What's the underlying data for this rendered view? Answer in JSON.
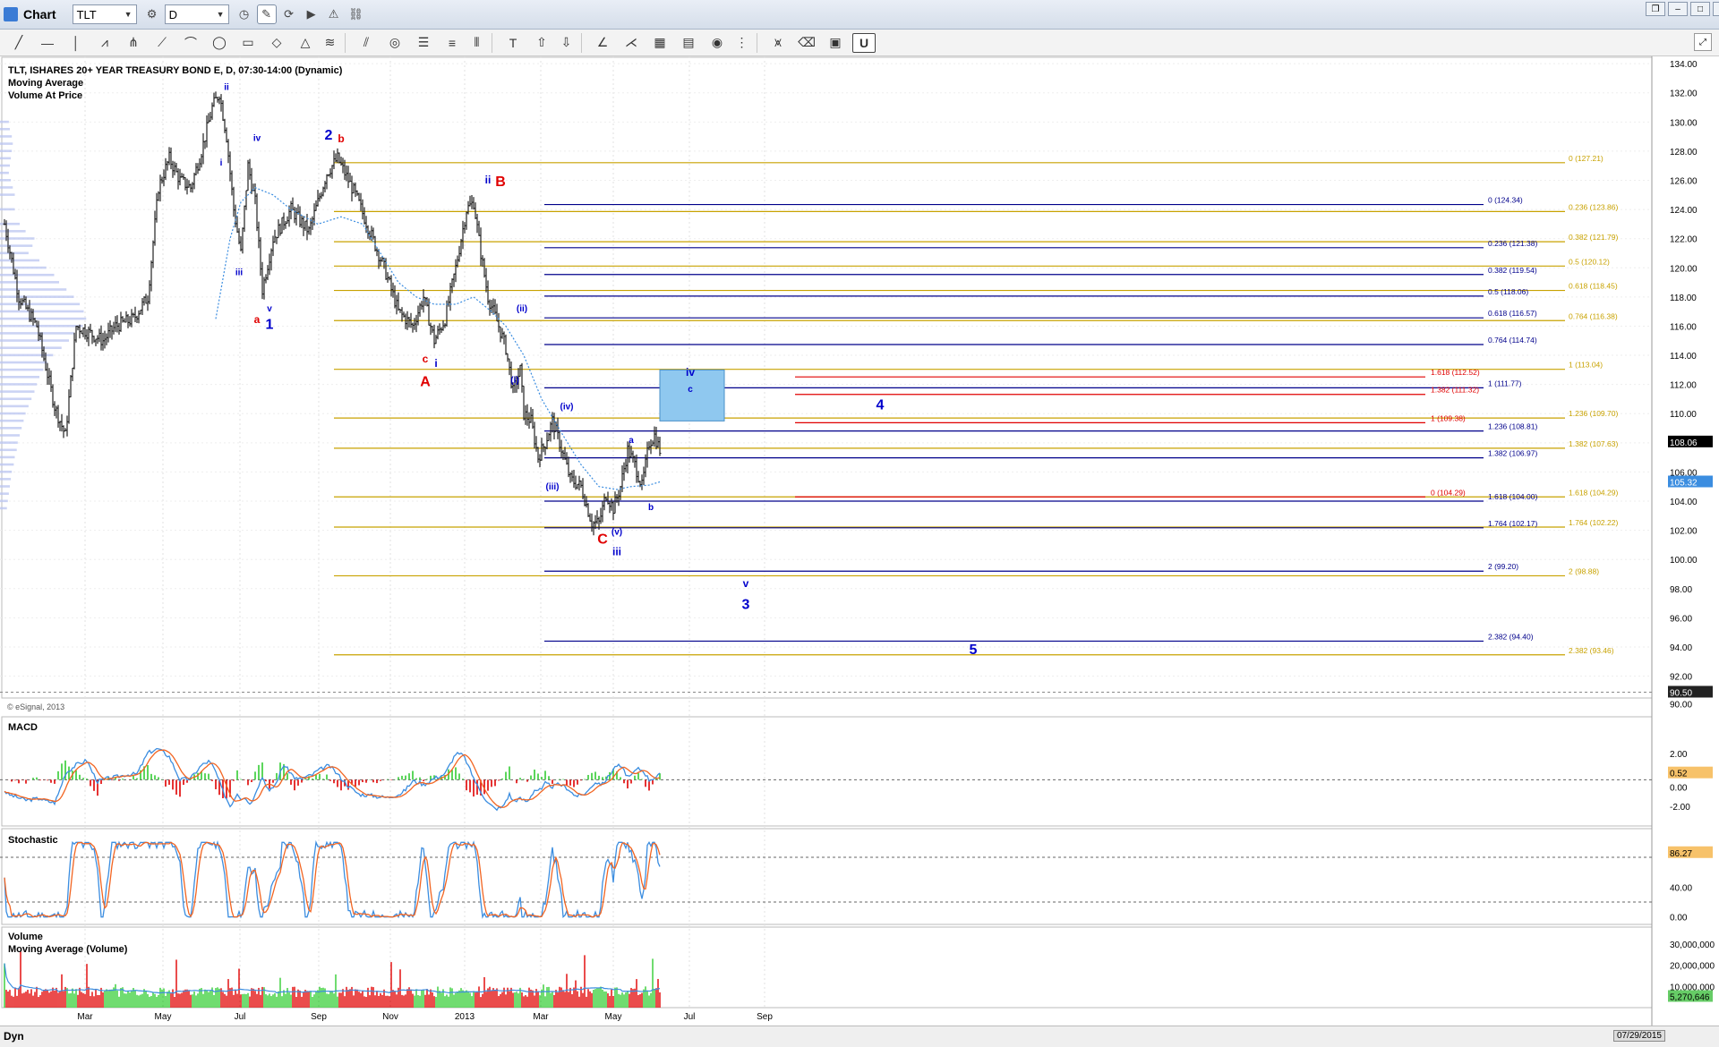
{
  "window": {
    "title": "Chart",
    "symbol": "TLT",
    "interval": "D"
  },
  "legend": {
    "title": "TLT, ISHARES 20+ YEAR TREASURY BOND E, D, 07:30-14:00 (Dynamic)",
    "ind1": "Moving Average",
    "ind2": "Volume At Price",
    "copyright": "© eSignal, 2013"
  },
  "colors": {
    "gold": "#c8a200",
    "blue": "#00008b",
    "red": "#e00000",
    "wave_blue": "#0000cc",
    "ma": "#3b8de0",
    "macd_orange": "#f26522",
    "green": "#33cc33",
    "box_fill": "#8fc8ef"
  },
  "chart_data": [
    {
      "type": "bar",
      "title": "TLT, ISHARES 20+ YEAR TREASURY BOND E, D, 07:30-14:00 (Dynamic)",
      "x_ticks": [
        "Mar",
        "May",
        "Jul",
        "Sep",
        "Nov",
        "2013",
        "Mar",
        "May",
        "Jul",
        "Sep"
      ],
      "ylim": [
        90.5,
        134.5
      ],
      "y_ticks": [
        134,
        132,
        130,
        128,
        126,
        124,
        122,
        120,
        118,
        116,
        114,
        112,
        110,
        108,
        106,
        104,
        102,
        100,
        98,
        96,
        94,
        92
      ],
      "last_price": "108.06",
      "ma_value": "105.32",
      "lower_value": "90.50",
      "lower_tick": "90.00",
      "ohlc_keyframes": [
        [
          0,
          123
        ],
        [
          8,
          118
        ],
        [
          18,
          116
        ],
        [
          28,
          110.5
        ],
        [
          34,
          108.5
        ],
        [
          40,
          116
        ],
        [
          48,
          115.5
        ],
        [
          55,
          115
        ],
        [
          62,
          116
        ],
        [
          72,
          116.5
        ],
        [
          80,
          118
        ],
        [
          86,
          125.5
        ],
        [
          92,
          127.5
        ],
        [
          98,
          126
        ],
        [
          104,
          125.5
        ],
        [
          110,
          128
        ],
        [
          116,
          131
        ],
        [
          120,
          132
        ],
        [
          124,
          129
        ],
        [
          128,
          124
        ],
        [
          132,
          121
        ],
        [
          136,
          127
        ],
        [
          140,
          124.5
        ],
        [
          144,
          118.5
        ],
        [
          150,
          122
        ],
        [
          160,
          124
        ],
        [
          170,
          122.5
        ],
        [
          180,
          126.5
        ],
        [
          186,
          127.5
        ],
        [
          196,
          125
        ],
        [
          204,
          122.5
        ],
        [
          212,
          120
        ],
        [
          220,
          117
        ],
        [
          228,
          116
        ],
        [
          234,
          118
        ],
        [
          240,
          115
        ],
        [
          246,
          116.5
        ],
        [
          252,
          120
        ],
        [
          258,
          124
        ],
        [
          262,
          124.5
        ],
        [
          266,
          121
        ],
        [
          270,
          118
        ],
        [
          276,
          116
        ],
        [
          280,
          114.5
        ],
        [
          284,
          111.5
        ],
        [
          288,
          113
        ],
        [
          290,
          110
        ],
        [
          294,
          109.5
        ],
        [
          298,
          107
        ],
        [
          302,
          108
        ],
        [
          306,
          109.5
        ],
        [
          310,
          108
        ],
        [
          316,
          105.5
        ],
        [
          322,
          105
        ],
        [
          328,
          102.5
        ],
        [
          332,
          102.5
        ],
        [
          336,
          104.5
        ],
        [
          340,
          103.5
        ],
        [
          344,
          105
        ],
        [
          348,
          107.5
        ],
        [
          352,
          106.5
        ],
        [
          356,
          105
        ],
        [
          360,
          108
        ],
        [
          363,
          108.5
        ],
        [
          366,
          107.5
        ]
      ],
      "moving_average": [
        [
          118,
          116.5
        ],
        [
          126,
          122
        ],
        [
          132,
          124.5
        ],
        [
          140,
          125.5
        ],
        [
          150,
          125
        ],
        [
          160,
          124
        ],
        [
          175,
          123
        ],
        [
          188,
          123.5
        ],
        [
          200,
          123
        ],
        [
          210,
          121
        ],
        [
          220,
          119
        ],
        [
          230,
          118
        ],
        [
          240,
          117.5
        ],
        [
          252,
          117.5
        ],
        [
          262,
          118
        ],
        [
          272,
          117
        ],
        [
          280,
          116
        ],
        [
          290,
          114
        ],
        [
          300,
          111
        ],
        [
          312,
          108.5
        ],
        [
          322,
          106.5
        ],
        [
          332,
          105
        ],
        [
          342,
          104.8
        ],
        [
          350,
          105
        ],
        [
          360,
          105.1
        ],
        [
          366,
          105.32
        ]
      ],
      "fib_gold": [
        {
          "level": "0",
          "value": 127.21
        },
        {
          "level": "0.236",
          "value": 123.86
        },
        {
          "level": "0.382",
          "value": 121.79
        },
        {
          "level": "0.5",
          "value": 120.12
        },
        {
          "level": "0.618",
          "value": 118.45
        },
        {
          "level": "0.764",
          "value": 116.38
        },
        {
          "level": "1",
          "value": 113.04
        },
        {
          "level": "1.236",
          "value": 109.7
        },
        {
          "level": "1.382",
          "value": 107.63
        },
        {
          "level": "1.618",
          "value": 104.29
        },
        {
          "level": "1.764",
          "value": 102.22
        },
        {
          "level": "2",
          "value": 98.88
        },
        {
          "level": "2.382",
          "value": 93.46
        }
      ],
      "fib_blue": [
        {
          "level": "0",
          "value": 124.34
        },
        {
          "level": "0.236",
          "value": 121.38
        },
        {
          "level": "0.382",
          "value": 119.54
        },
        {
          "level": "0.5",
          "value": 118.06
        },
        {
          "level": "0.618",
          "value": 116.57
        },
        {
          "level": "0.764",
          "value": 114.74
        },
        {
          "level": "1",
          "value": 111.77
        },
        {
          "level": "1.236",
          "value": 108.81
        },
        {
          "level": "1.382",
          "value": 106.97
        },
        {
          "level": "1.618",
          "value": 104.0
        },
        {
          "level": "1.764",
          "value": 102.17
        },
        {
          "level": "2",
          "value": 99.2
        },
        {
          "level": "2.382",
          "value": 94.4
        }
      ],
      "fib_red": [
        {
          "level": "0",
          "value": 104.29
        },
        {
          "level": "1",
          "value": 109.38
        },
        {
          "level": "1.382",
          "value": 111.32
        },
        {
          "level": "1.618",
          "value": 112.52
        }
      ],
      "target_box": {
        "x_from": 366,
        "x_to": 402,
        "y_from": 109.5,
        "y_to": 113.0
      },
      "wave_labels": [
        {
          "t": "ii",
          "x": 124,
          "y": 132.2,
          "c": "b",
          "s": "s"
        },
        {
          "t": "i",
          "x": 121,
          "y": 127,
          "c": "b",
          "s": "s"
        },
        {
          "t": "iii",
          "x": 131,
          "y": 119.5,
          "c": "b",
          "s": "s"
        },
        {
          "t": "iv",
          "x": 141,
          "y": 128.7,
          "c": "b",
          "s": "s"
        },
        {
          "t": "v",
          "x": 148,
          "y": 117,
          "c": "b",
          "s": "s"
        },
        {
          "t": "a",
          "x": 141,
          "y": 116.2,
          "c": "r",
          "s": "m"
        },
        {
          "t": "1",
          "x": 148,
          "y": 115.8,
          "c": "b",
          "s": "l"
        },
        {
          "t": "2",
          "x": 181,
          "y": 128.8,
          "c": "b",
          "s": "l"
        },
        {
          "t": "b",
          "x": 188,
          "y": 128.6,
          "c": "r",
          "s": "m"
        },
        {
          "t": "c",
          "x": 235,
          "y": 113.5,
          "c": "r",
          "s": "m"
        },
        {
          "t": "i",
          "x": 241,
          "y": 113.2,
          "c": "b",
          "s": "m"
        },
        {
          "t": "A",
          "x": 235,
          "y": 111.9,
          "c": "r",
          "s": "l"
        },
        {
          "t": "ii",
          "x": 270,
          "y": 125.8,
          "c": "b",
          "s": "m"
        },
        {
          "t": "B",
          "x": 277,
          "y": 125.6,
          "c": "r",
          "s": "l"
        },
        {
          "t": "(ii)",
          "x": 289,
          "y": 117,
          "c": "b",
          "s": "s"
        },
        {
          "t": "(i)",
          "x": 285,
          "y": 112.1,
          "c": "b",
          "s": "s"
        },
        {
          "t": "(iv)",
          "x": 314,
          "y": 110.3,
          "c": "b",
          "s": "s"
        },
        {
          "t": "(iii)",
          "x": 306,
          "y": 104.8,
          "c": "b",
          "s": "s"
        },
        {
          "t": "C",
          "x": 334,
          "y": 101.1,
          "c": "r",
          "s": "l"
        },
        {
          "t": "(v)",
          "x": 342,
          "y": 101.7,
          "c": "b",
          "s": "s"
        },
        {
          "t": "iii",
          "x": 342,
          "y": 100.3,
          "c": "b",
          "s": "m"
        },
        {
          "t": "a",
          "x": 350,
          "y": 108,
          "c": "b",
          "s": "s"
        },
        {
          "t": "b",
          "x": 361,
          "y": 103.4,
          "c": "b",
          "s": "s"
        },
        {
          "t": "iv",
          "x": 383,
          "y": 112.6,
          "c": "b",
          "s": "m"
        },
        {
          "t": "c",
          "x": 383,
          "y": 111.5,
          "c": "b",
          "s": "s"
        },
        {
          "t": "4",
          "x": 489,
          "y": 110.3,
          "c": "b",
          "s": "l"
        },
        {
          "t": "v",
          "x": 414,
          "y": 98.1,
          "c": "b",
          "s": "m"
        },
        {
          "t": "3",
          "x": 414,
          "y": 96.6,
          "c": "b",
          "s": "l"
        },
        {
          "t": "5",
          "x": 541,
          "y": 93.5,
          "c": "b",
          "s": "l"
        }
      ]
    },
    {
      "type": "line",
      "title": "MACD",
      "ylim": [
        -3.5,
        4.5
      ],
      "y_ticks": [
        "2.00",
        "-2.00"
      ],
      "last": "0.52",
      "zero_label": "0.00"
    },
    {
      "type": "line",
      "title": "Stochastic",
      "ylim": [
        -10,
        110
      ],
      "y_ticks": [
        "40.00",
        "0.00"
      ],
      "last": "86.27",
      "upper": 80,
      "lower": 20
    },
    {
      "type": "bar",
      "title": "Volume",
      "subtitle": "Moving Average (Volume)",
      "ylim": [
        0,
        35000000
      ],
      "y_ticks": [
        "30,000,000",
        "20,000,000",
        "10,000,000"
      ],
      "last": "5,270,646"
    }
  ],
  "statusbar": {
    "mode": "Dyn",
    "date": "07/29/2015"
  }
}
